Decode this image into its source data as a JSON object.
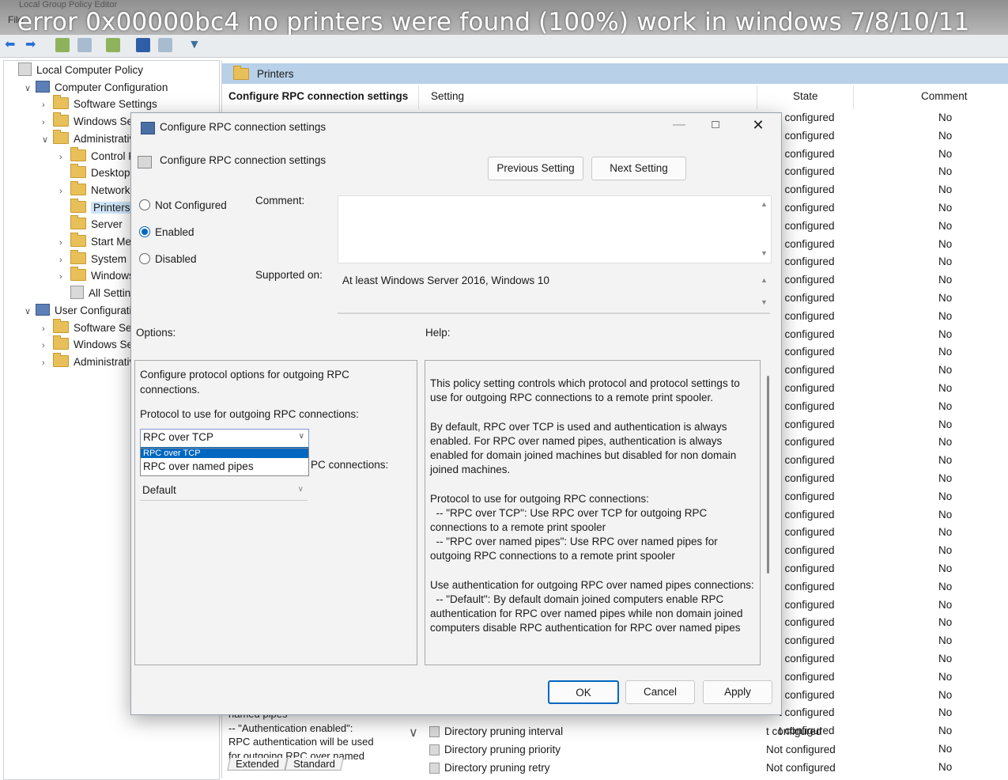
{
  "video_title": "error 0x00000bc4 no printers were found (100%) work in windows 7/8/10/11",
  "bg_window": {
    "app_title": "Local Group Policy Editor",
    "menu_file": "File"
  },
  "tree": {
    "items": [
      {
        "label": "Local Computer Policy",
        "indent": 0,
        "expander": "",
        "icon": "policy"
      },
      {
        "label": "Computer Configuration",
        "indent": 1,
        "expander": "v",
        "icon": "pc"
      },
      {
        "label": "Software Settings",
        "indent": 2,
        "expander": ">",
        "icon": "folder"
      },
      {
        "label": "Windows Setti",
        "indent": 2,
        "expander": ">",
        "icon": "folder"
      },
      {
        "label": "Administrative",
        "indent": 2,
        "expander": "v",
        "icon": "folder"
      },
      {
        "label": "Control Pa",
        "indent": 3,
        "expander": ">",
        "icon": "folder"
      },
      {
        "label": "Desktop",
        "indent": 3,
        "expander": "",
        "icon": "folder"
      },
      {
        "label": "Network",
        "indent": 3,
        "expander": ">",
        "icon": "folder"
      },
      {
        "label": "Printers",
        "indent": 3,
        "expander": "",
        "icon": "folder",
        "selected": true
      },
      {
        "label": "Server",
        "indent": 3,
        "expander": "",
        "icon": "folder"
      },
      {
        "label": "Start Menu",
        "indent": 3,
        "expander": ">",
        "icon": "folder"
      },
      {
        "label": "System",
        "indent": 3,
        "expander": ">",
        "icon": "folder"
      },
      {
        "label": "Windows (",
        "indent": 3,
        "expander": ">",
        "icon": "folder"
      },
      {
        "label": "All Setting",
        "indent": 3,
        "expander": "",
        "icon": "policy"
      },
      {
        "label": "User Configuratio",
        "indent": 1,
        "expander": "v",
        "icon": "pc"
      },
      {
        "label": "Software Setti",
        "indent": 2,
        "expander": ">",
        "icon": "folder"
      },
      {
        "label": "Windows Setti",
        "indent": 2,
        "expander": ">",
        "icon": "folder"
      },
      {
        "label": "Administrative",
        "indent": 2,
        "expander": ">",
        "icon": "folder"
      }
    ]
  },
  "right_pane": {
    "folder_title": "Printers",
    "selected_setting_title": "Configure RPC connection settings",
    "columns": {
      "setting": "Setting",
      "state": "State",
      "comment": "Comment"
    },
    "state_values": [
      "t configured",
      "t configured",
      "t configured",
      "t configured",
      "t configured",
      "t configured",
      "t configured",
      "t configured",
      "t configured",
      "t configured",
      "t configured",
      "t configured",
      "t configured",
      "t configured",
      "t configured",
      "t configured",
      "t configured",
      "t configured",
      "t configured",
      "t configured",
      "t configured",
      "t configured",
      "t configured",
      "t configured",
      "t configured",
      "t configured",
      "t configured",
      "t configured",
      "t configured",
      "t configured",
      "t configured",
      "t configured",
      "t configured",
      "t configured",
      "t configured"
    ],
    "comment_values": [
      "No",
      "No",
      "No",
      "No",
      "No",
      "No",
      "No",
      "No",
      "No",
      "No",
      "No",
      "No",
      "No",
      "No",
      "No",
      "No",
      "No",
      "No",
      "No",
      "No",
      "No",
      "No",
      "No",
      "No",
      "No",
      "No",
      "No",
      "No",
      "No",
      "No",
      "No",
      "No",
      "No",
      "No",
      "No",
      "No",
      "No"
    ],
    "bottom_desc_lines": [
      "named pipes",
      "-- \"Authentication enabled\":",
      "RPC authentication will be used",
      "for outgoing RPC over named"
    ],
    "bottom_rows": [
      {
        "name": "Directory pruning interval",
        "state": "t configured"
      },
      {
        "name": "Directory pruning priority",
        "state": "Not configured"
      },
      {
        "name": "Directory pruning retry",
        "state": "Not configured"
      }
    ],
    "view_tabs": [
      "Extended",
      "Standard"
    ]
  },
  "dialog": {
    "title": "Configure RPC connection settings",
    "setting_name": "Configure RPC connection settings",
    "prev_label": "Previous Setting",
    "next_label": "Next Setting",
    "radio_not_configured": "Not Configured",
    "radio_enabled": "Enabled",
    "radio_disabled": "Disabled",
    "selected_state": "Enabled",
    "comment_label": "Comment:",
    "comment_value": "",
    "supported_label": "Supported on:",
    "supported_value": "At least Windows Server 2016, Windows 10",
    "options_label": "Options:",
    "help_label": "Help:",
    "options": {
      "description": "Configure protocol options for outgoing RPC connections.",
      "protocol_label": "Protocol to use for outgoing RPC connections:",
      "protocol_value": "RPC over TCP",
      "protocol_options": [
        "RPC over TCP",
        "RPC over named pipes"
      ],
      "auth_label_partial": "PC connections:",
      "auth_value": "Default"
    },
    "help_text": "This policy setting controls which protocol and protocol settings to use for outgoing RPC connections to a remote print spooler.\n\nBy default, RPC over TCP is used and authentication is always enabled. For RPC over named pipes, authentication is always enabled for domain joined machines but disabled for non domain joined machines.\n\nProtocol to use for outgoing RPC connections:\n  -- \"RPC over TCP\": Use RPC over TCP for outgoing RPC connections to a remote print spooler\n  -- \"RPC over named pipes\": Use RPC over named pipes for outgoing RPC connections to a remote print spooler\n\nUse authentication for outgoing RPC over named pipes connections:\n  -- \"Default\": By default domain joined computers enable RPC authentication for RPC over named pipes while non domain joined computers disable RPC authentication for RPC over named pipes",
    "ok_label": "OK",
    "cancel_label": "Cancel",
    "apply_label": "Apply"
  },
  "colors": {
    "accent": "#0067c0",
    "folder": "#e8c05a",
    "header_band": "#b8d0e8"
  }
}
